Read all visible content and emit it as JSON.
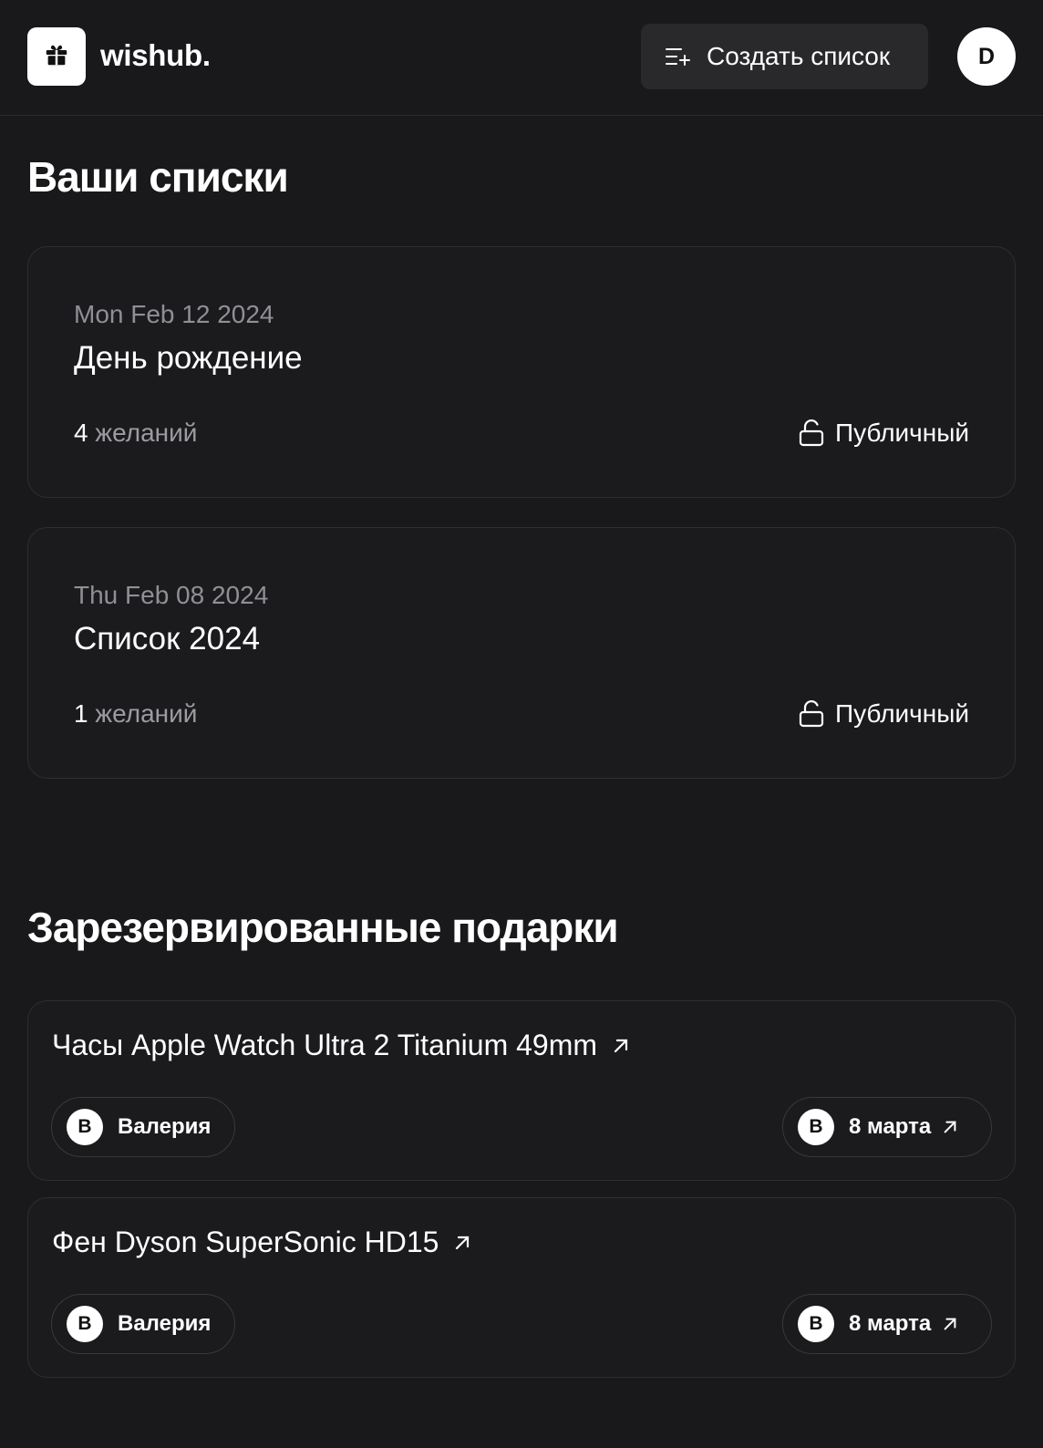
{
  "header": {
    "brand": "wishub.",
    "logo_icon": "gift-icon",
    "create_button": {
      "label": "Создать список",
      "icon": "list-plus-icon"
    },
    "user_avatar": "D"
  },
  "lists_section": {
    "title": "Ваши списки",
    "lists": [
      {
        "date": "Mon Feb 12 2024",
        "name": "День рождение",
        "count": "4",
        "count_label": "желаний",
        "visibility": "Публичный",
        "visibility_icon": "unlock-icon"
      },
      {
        "date": "Thu Feb 08 2024",
        "name": "Список 2024",
        "count": "1",
        "count_label": "желаний",
        "visibility": "Публичный",
        "visibility_icon": "unlock-icon"
      }
    ]
  },
  "reserved_section": {
    "title": "Зарезервированные подарки",
    "gifts": [
      {
        "title": "Часы Apple Watch Ultra 2 Titanium 49mm",
        "user_initial": "В",
        "user_name": "Валерия",
        "list_initial": "В",
        "list_name": "8 марта"
      },
      {
        "title": "Фен Dyson SuperSonic HD15",
        "user_initial": "В",
        "user_name": "Валерия",
        "list_initial": "В",
        "list_name": "8 марта"
      }
    ]
  },
  "colors": {
    "background": "#19191b",
    "card_border": "#2e2e33",
    "muted_text": "#8f8f95",
    "button_bg": "#29292c"
  }
}
